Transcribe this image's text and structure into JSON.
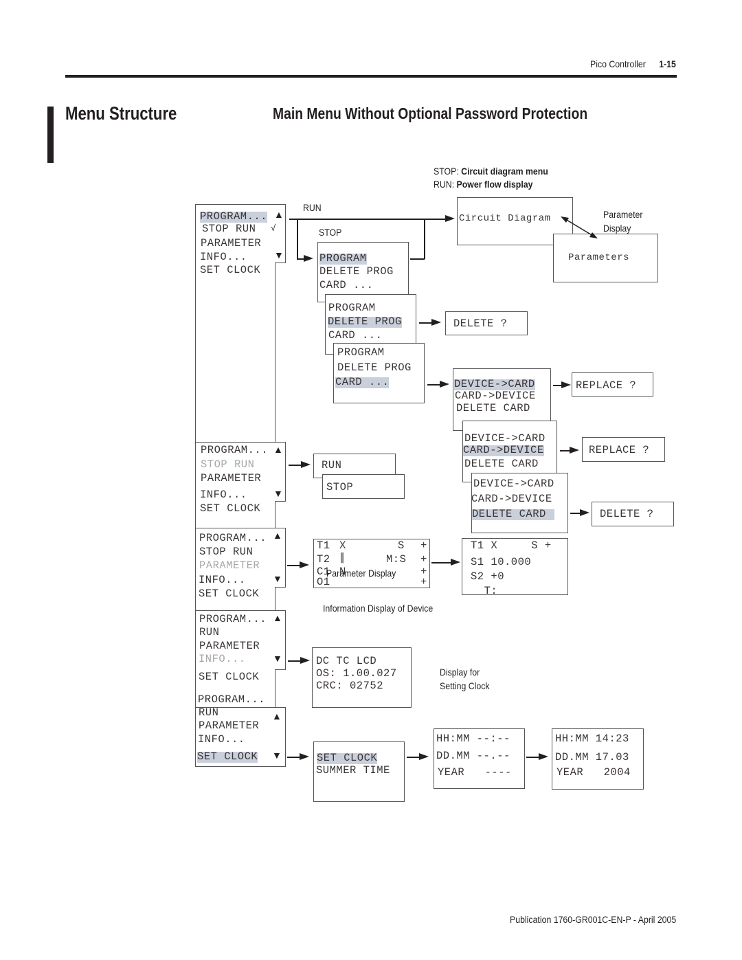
{
  "header": {
    "running_title": "Pico Controller",
    "page_number": "1-15"
  },
  "section_title": "Menu Structure",
  "subsection_title": "Main Menu Without Optional Password Protection",
  "legend": {
    "stop_prefix": "STOP:",
    "stop_text": "Circuit diagram menu",
    "run_prefix": "RUN:",
    "run_text": "Power flow display"
  },
  "flow_labels": {
    "run": "RUN",
    "stop": "STOP",
    "parameter_display_caption": "Parameter\nDisplay",
    "parameter_display_overlay": "Parameter Display",
    "info_caption": "Information Display of Device",
    "clock_caption_line1": "Display for",
    "clock_caption_line2": "Setting Clock"
  },
  "main_menus": [
    {
      "items": [
        "PROGRAM...",
        "STOP RUN",
        "PARAMETER",
        "INFO...",
        "SET CLOCK"
      ],
      "highlighted": "PROGRAM..."
    },
    {
      "items": [
        "PROGRAM...",
        "STOP RUN",
        "PARAMETER",
        "INFO...",
        "SET CLOCK"
      ],
      "highlighted": "STOP RUN"
    },
    {
      "items": [
        "PROGRAM...",
        "STOP RUN",
        "PARAMETER",
        "INFO...",
        "SET CLOCK"
      ],
      "highlighted": "PARAMETER"
    },
    {
      "items": [
        "PROGRAM...",
        "RUN",
        "PARAMETER",
        "INFO...",
        "SET CLOCK"
      ],
      "highlighted": "INFO..."
    },
    {
      "items": [
        "PROGRAM...",
        "RUN",
        "PARAMETER",
        "INFO...",
        "SET CLOCK"
      ],
      "highlighted": "SET CLOCK"
    }
  ],
  "screens": {
    "circuit_diagram": "Circuit Diagram",
    "parameters": "Parameters",
    "program_menu": [
      "PROGRAM",
      "DELETE PROG",
      "CARD ..."
    ],
    "delete_prompt": "DELETE ?",
    "card_menu": [
      "DEVICE->CARD",
      "CARD->DEVICE",
      "DELETE CARD"
    ],
    "replace_prompt": "REPLACE ?",
    "run_stop": [
      "RUN",
      "STOP"
    ],
    "parameter_list": [
      [
        "T1",
        "X",
        "S",
        "+"
      ],
      [
        "T2",
        "∥",
        "M:S",
        "+"
      ],
      [
        "C1",
        "N",
        "",
        "+"
      ],
      [
        "O1",
        "",
        "",
        "+"
      ]
    ],
    "parameter_detail": [
      "T1 X     S +",
      "S1 10.000",
      "S2 +0",
      "  T:"
    ],
    "info": [
      "DC TC LCD",
      "OS: 1.00.027",
      "CRC: 02752"
    ],
    "clock_menu": [
      "SET CLOCK",
      "SUMMER TIME"
    ],
    "clock_empty": [
      "HH:MM --:--",
      "DD.MM --.--",
      "YEAR   ----"
    ],
    "clock_set": [
      "HH:MM 14:23",
      "DD.MM 17.03",
      "YEAR   2004"
    ]
  },
  "colors": {
    "highlight": "#c9d0dc",
    "dimmed": "#a8a8a8",
    "ink": "#231f20"
  },
  "footer": "Publication 1760-GR001C-EN-P - April 2005"
}
